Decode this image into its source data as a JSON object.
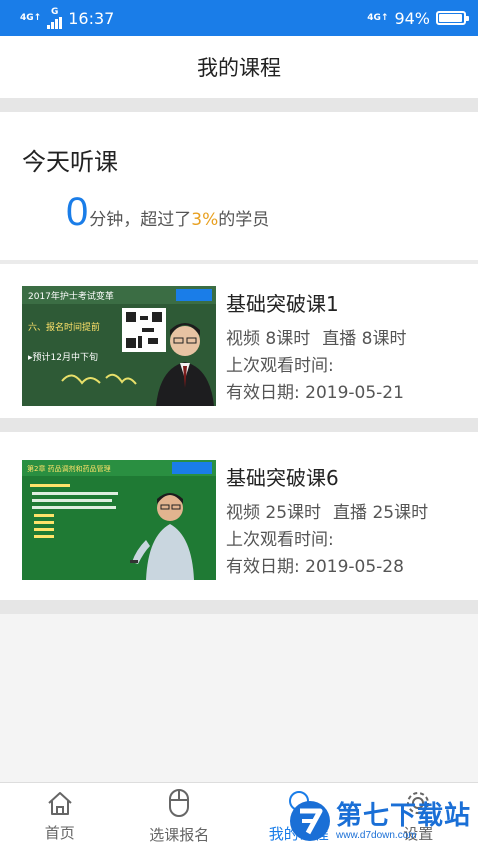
{
  "status_bar": {
    "time": "16:37",
    "net_tag_left": "4G↑",
    "net_tag_left2": "G",
    "net_tag_right": "4G↑",
    "battery_text": "94%",
    "battery_level": 0.94
  },
  "header": {
    "title": "我的课程"
  },
  "today": {
    "title": "今天听课",
    "minutes": "0",
    "text_before": "分钟，超过了",
    "percent": "3%",
    "text_after": "的学员"
  },
  "courses": [
    {
      "title": "基础突破课1",
      "video": "视频 8课时",
      "live": "直播 8课时",
      "last_watch": "上次观看时间:",
      "valid": "有效日期: 2019-05-21",
      "thumb_caption_top": "2017年护士考试变革",
      "thumb_line1": "六、报名时间提前",
      "thumb_line2": "▸预计12月中下旬"
    },
    {
      "title": "基础突破课6",
      "video": "视频 25课时",
      "live": "直播 25课时",
      "last_watch": "上次观看时间:",
      "valid": "有效日期: 2019-05-28",
      "thumb_caption_top": "第2章 药品调剂和药品管理"
    }
  ],
  "tabs": [
    {
      "label": "首页",
      "icon": "home-icon"
    },
    {
      "label": "选课报名",
      "icon": "mouse-icon"
    },
    {
      "label": "我的课程",
      "icon": "course-icon"
    },
    {
      "label": "设置",
      "icon": "gear-icon"
    }
  ],
  "watermark": {
    "main": "第七下载站",
    "url": "www.d7down.com"
  },
  "colors": {
    "accent": "#1a7de8",
    "highlight": "#e8a020"
  }
}
